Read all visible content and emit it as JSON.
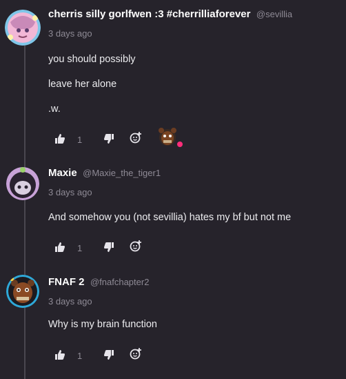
{
  "comments": [
    {
      "author": "cherris silly gorlfwen :3 #cherrilliaforever",
      "handle": "@sevillia",
      "time": "3 days ago",
      "lines": [
        "you should possibly",
        "leave her alone",
        ".w."
      ],
      "likes": "1"
    },
    {
      "author": "Maxie",
      "handle": "@Maxie_the_tiger1",
      "time": "3 days ago",
      "lines": [
        "And somehow you (not sevillia) hates my bf but not me"
      ],
      "likes": "1"
    },
    {
      "author": "FNAF 2",
      "handle": "@fnafchapter2",
      "time": "3 days ago",
      "lines": [
        "Why is my brain function"
      ],
      "likes": "1"
    }
  ],
  "icons": {
    "like": "thumbs-up-icon",
    "dislike": "thumbs-down-icon",
    "react": "add-reaction-icon"
  },
  "colors": {
    "background": "#26232b",
    "text_muted": "#8e8a95",
    "reaction_badge": "#ff2d7a"
  }
}
